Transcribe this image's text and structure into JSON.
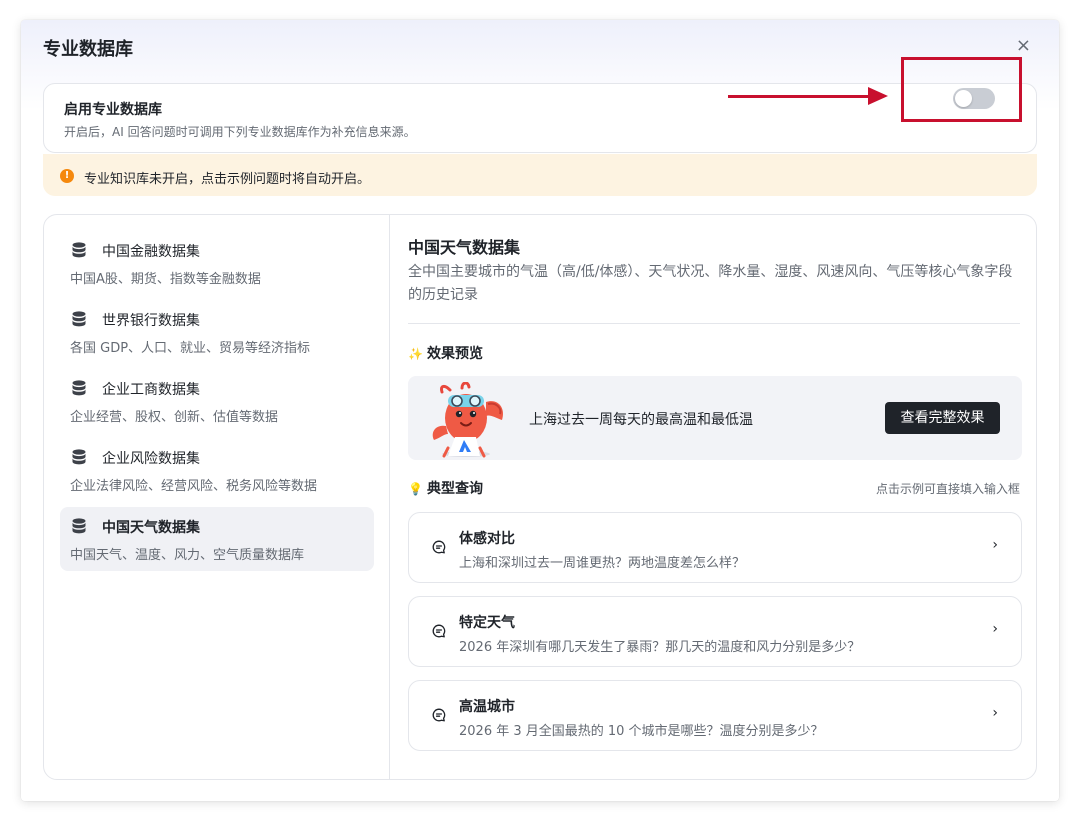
{
  "dialog": {
    "title": "专业数据库",
    "close_label": "×"
  },
  "enable": {
    "title": "启用专业数据库",
    "description": "开启后，AI 回答问题时可调用下列专业数据库作为补充信息来源。",
    "toggle_on": false
  },
  "warning": {
    "icon": "!",
    "text": "专业知识库未开启，点击示例问题时将自动开启。",
    "color": "#f5880c"
  },
  "datasets": [
    {
      "name": "中国金融数据集",
      "desc": "中国A股、期货、指数等金融数据",
      "icon": "database-icon",
      "active": false
    },
    {
      "name": "世界银行数据集",
      "desc": "各国 GDP、人口、就业、贸易等经济指标",
      "icon": "database-icon",
      "active": false
    },
    {
      "name": "企业工商数据集",
      "desc": "企业经营、股权、创新、估值等数据",
      "icon": "database-icon",
      "active": false
    },
    {
      "name": "企业风险数据集",
      "desc": "企业法律风险、经营风险、税务风险等数据",
      "icon": "database-icon",
      "active": false
    },
    {
      "name": "中国天气数据集",
      "desc": "中国天气、温度、风力、空气质量数据库",
      "icon": "database-icon",
      "active": true
    }
  ],
  "detail": {
    "title": "中国天气数据集",
    "description": "全中国主要城市的气温（高/低/体感）、天气状况、降水量、湿度、风速风向、气压等核心气象字段的历史记录",
    "preview_heading": "效果预览",
    "preview_text": "上海过去一周每天的最高温和最低温",
    "preview_button": "查看完整效果",
    "queries_heading": "典型查询",
    "queries_hint": "点击示例可直接填入输入框",
    "queries": [
      {
        "title": "体感对比",
        "text": "上海和深圳过去一周谁更热？两地温度差怎么样？"
      },
      {
        "title": "特定天气",
        "text": "2026 年深圳有哪几天发生了暴雨？那几天的温度和风力分别是多少？"
      },
      {
        "title": "高温城市",
        "text": "2026 年 3 月全国最热的 10 个城市是哪些？温度分别是多少？"
      }
    ]
  },
  "colors": {
    "accent_red": "#c8102e",
    "dark_button": "#1f2329",
    "warning_bg": "#fdf3e1"
  }
}
